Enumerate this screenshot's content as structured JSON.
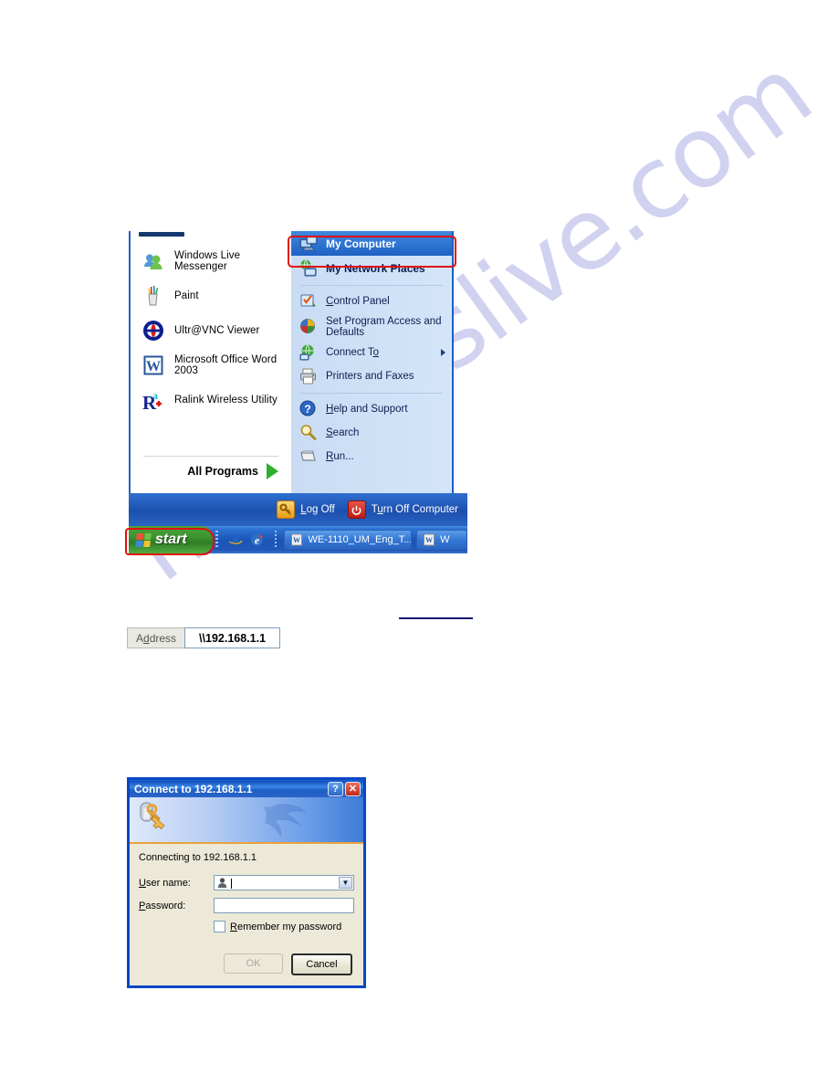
{
  "watermark": {
    "text": "manualslive.com"
  },
  "start_menu": {
    "programs": [
      {
        "label": "Windows Live Messenger",
        "icon": "messenger-icon"
      },
      {
        "label": "Paint",
        "icon": "paint-icon"
      },
      {
        "label": "Ultr@VNC Viewer",
        "icon": "vnc-icon"
      },
      {
        "label": "Microsoft Office Word 2003",
        "icon": "word-icon"
      },
      {
        "label": "Ralink Wireless Utility",
        "icon": "ralink-icon"
      }
    ],
    "all_programs": "All Programs",
    "right_items": [
      {
        "label": "My Computer",
        "icon": "computer-icon",
        "selected": true,
        "bold": true
      },
      {
        "label": "My Network Places",
        "icon": "network-icon",
        "selected": false,
        "bold": true
      },
      {
        "label": "Control Panel",
        "icon": "control-panel-icon",
        "selected": false,
        "bold": false
      },
      {
        "label": "Set Program Access and Defaults",
        "icon": "program-access-icon",
        "selected": false,
        "bold": false
      },
      {
        "label": "Connect To",
        "icon": "connect-to-icon",
        "selected": false,
        "bold": false,
        "submenu": true
      },
      {
        "label": "Printers and Faxes",
        "icon": "printer-icon",
        "selected": false,
        "bold": false
      },
      {
        "label": "Help and Support",
        "icon": "help-icon",
        "selected": false,
        "bold": false
      },
      {
        "label": "Search",
        "icon": "search-icon",
        "selected": false,
        "bold": false
      },
      {
        "label": "Run...",
        "icon": "run-icon",
        "selected": false,
        "bold": false
      }
    ],
    "log_off": "Log Off",
    "turn_off": "Turn Off Computer"
  },
  "taskbar": {
    "start_label": "start",
    "quick_launch": [
      {
        "name": "internet-explorer-icon"
      },
      {
        "name": "browser-icon"
      }
    ],
    "tasks": [
      {
        "label": "WE-1110_UM_Eng_T...",
        "icon": "word-doc-icon"
      },
      {
        "label": "W",
        "icon": "word-doc-icon"
      }
    ]
  },
  "address_bar": {
    "label": "Address",
    "value": "\\\\192.168.1.1"
  },
  "dialog": {
    "title": "Connect to 192.168.1.1",
    "help_glyph": "?",
    "close_glyph": "✕",
    "message": "Connecting to 192.168.1.1",
    "username_label": "User name:",
    "username_value": "",
    "password_label": "Password:",
    "password_value": "",
    "remember_label": "Remember my password",
    "remember_checked": false,
    "ok_label": "OK",
    "cancel_label": "Cancel"
  },
  "colors": {
    "highlight_red": "#e01010",
    "xp_blue": "#1c55b8",
    "start_green": "#3e9430",
    "panel_blue": "#cddff5"
  }
}
